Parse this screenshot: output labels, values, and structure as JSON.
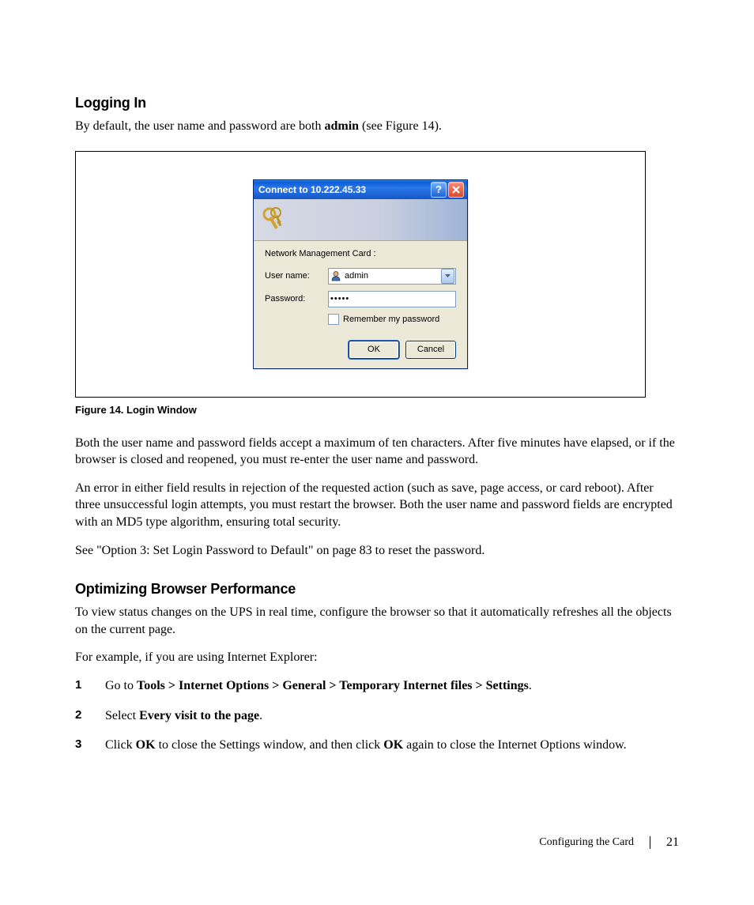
{
  "sections": {
    "logging_in": {
      "heading": "Logging In",
      "intro_pre": "By default, the user name and password are both ",
      "intro_bold": "admin",
      "intro_post": " (see Figure 14)."
    },
    "figure": {
      "caption": "Figure 14. Login Window"
    },
    "dialog": {
      "title": "Connect to 10.222.45.33",
      "prompt": "Network Management Card :",
      "username_label": "User name:",
      "username_value": "admin",
      "password_label": "Password:",
      "password_value": "•••••",
      "remember_label": "Remember my password",
      "ok_label": "OK",
      "cancel_label": "Cancel"
    },
    "after_figure": {
      "p1": "Both the user name and password fields accept a maximum of ten characters. After five minutes have elapsed, or if the browser is closed and reopened, you must re-enter the user name and password.",
      "p2": "An error in either field results in rejection of the requested action (such as save, page access, or card reboot). After three unsuccessful login attempts, you must restart the browser. Both the user name and password fields are encrypted with an MD5 type algorithm, ensuring total security.",
      "p3": "See \"Option 3: Set Login Password to Default\" on page 83 to reset the password."
    },
    "optimizing": {
      "heading": "Optimizing Browser Performance",
      "p1": "To view status changes on the UPS in real time, configure the browser so that it automatically refreshes all the objects on the current page.",
      "p2": "For example, if you are using Internet Explorer:",
      "steps": {
        "s1_pre": "Go to ",
        "s1_bold": "Tools > Internet Options > General > Temporary Internet files > Settings",
        "s1_post": ".",
        "s2_pre": "Select ",
        "s2_bold": "Every visit to the page",
        "s2_post": ".",
        "s3_pre": "Click ",
        "s3_bold1": "OK",
        "s3_mid": " to close the Settings window, and then click ",
        "s3_bold2": "OK",
        "s3_post": " again to close the Internet Options window."
      }
    },
    "footer": {
      "section_name": "Configuring the Card",
      "page_number": "21"
    }
  }
}
